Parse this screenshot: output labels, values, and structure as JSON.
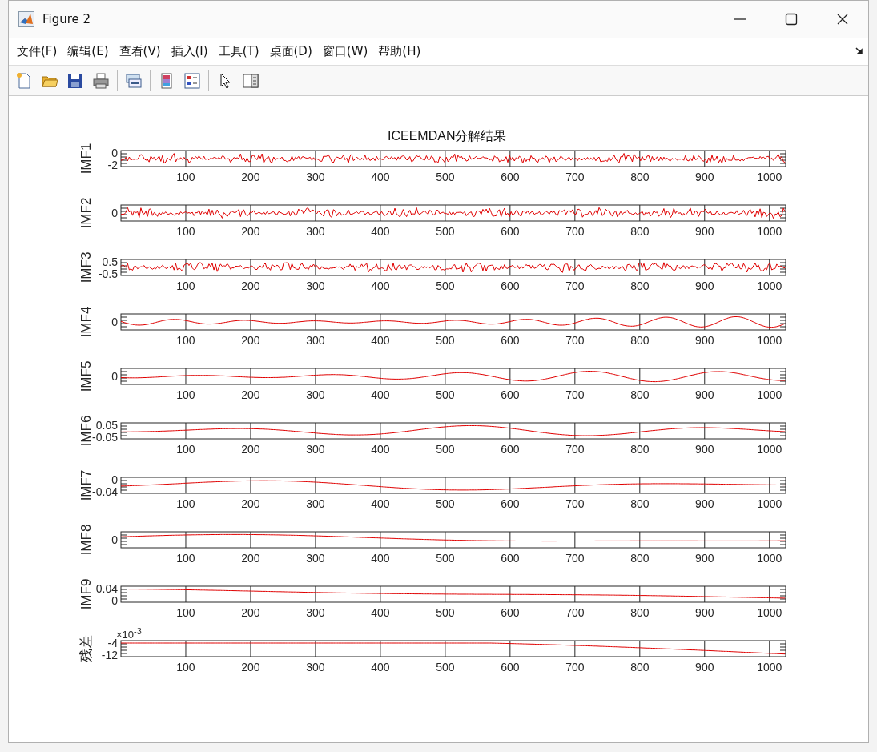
{
  "window": {
    "title": "Figure 2"
  },
  "menu": [
    "文件(F)",
    "编辑(E)",
    "查看(V)",
    "插入(I)",
    "工具(T)",
    "桌面(D)",
    "窗口(W)",
    "帮助(H)"
  ],
  "figure": {
    "title": "ICEEMDAN分解结果",
    "subplots": [
      {
        "ylabel": "IMF1",
        "yticks": [
          "0",
          "-2"
        ],
        "xticks": [
          "100",
          "200",
          "300",
          "400",
          "500",
          "600",
          "700",
          "800",
          "900",
          "1000"
        ]
      },
      {
        "ylabel": "IMF2",
        "yticks": [
          "0"
        ],
        "xticks": [
          "100",
          "200",
          "300",
          "400",
          "500",
          "600",
          "700",
          "800",
          "900",
          "1000"
        ]
      },
      {
        "ylabel": "IMF3",
        "yticks": [
          "0.5",
          "-0.5"
        ],
        "xticks": [
          "100",
          "200",
          "300",
          "400",
          "500",
          "600",
          "700",
          "800",
          "900",
          "1000"
        ]
      },
      {
        "ylabel": "IMF4",
        "yticks": [
          "0"
        ],
        "xticks": [
          "100",
          "200",
          "300",
          "400",
          "500",
          "600",
          "700",
          "800",
          "900",
          "1000"
        ]
      },
      {
        "ylabel": "IMF5",
        "yticks": [
          "0"
        ],
        "xticks": [
          "100",
          "200",
          "300",
          "400",
          "500",
          "600",
          "700",
          "800",
          "900",
          "1000"
        ]
      },
      {
        "ylabel": "IMF6",
        "yticks": [
          "0.05",
          "-0.05"
        ],
        "xticks": [
          "100",
          "200",
          "300",
          "400",
          "500",
          "600",
          "700",
          "800",
          "900",
          "1000"
        ]
      },
      {
        "ylabel": "IMF7",
        "yticks": [
          "0",
          "-0.04"
        ],
        "xticks": [
          "100",
          "200",
          "300",
          "400",
          "500",
          "600",
          "700",
          "800",
          "900",
          "1000"
        ]
      },
      {
        "ylabel": "IMF8",
        "yticks": [
          "0"
        ],
        "xticks": [
          "100",
          "200",
          "300",
          "400",
          "500",
          "600",
          "700",
          "800",
          "900",
          "1000"
        ]
      },
      {
        "ylabel": "IMF9",
        "yticks": [
          "0.04",
          "0"
        ],
        "xticks": [
          "100",
          "200",
          "300",
          "400",
          "500",
          "600",
          "700",
          "800",
          "900",
          "1000"
        ]
      },
      {
        "ylabel": "残差",
        "yticks": [
          "-4",
          "-12"
        ],
        "exponent": "×10$^{-3}$",
        "xticks": [
          "100",
          "200",
          "300",
          "400",
          "500",
          "600",
          "700",
          "800",
          "900",
          "1000"
        ]
      }
    ]
  }
}
